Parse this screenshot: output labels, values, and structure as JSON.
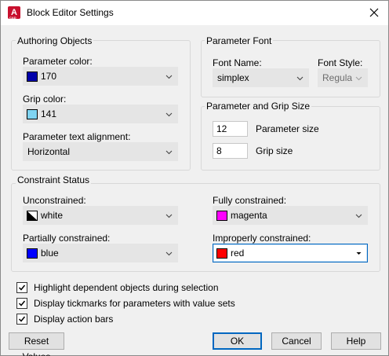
{
  "window": {
    "title": "Block Editor Settings",
    "app_icon_letter": "A",
    "app_icon_sub": "CAD"
  },
  "authoring": {
    "title": "Authoring Objects",
    "param_color_label": "Parameter color:",
    "param_color_value": "170",
    "param_color_swatch": "#0000aa",
    "grip_color_label": "Grip color:",
    "grip_color_value": "141",
    "grip_color_swatch": "#7fd4f2",
    "text_align_label": "Parameter text alignment:",
    "text_align_value": "Horizontal"
  },
  "param_font": {
    "title": "Parameter Font",
    "font_name_label": "Font Name:",
    "font_name_value": "simplex",
    "font_style_label": "Font Style:",
    "font_style_value": "Regula"
  },
  "size": {
    "title": "Parameter and Grip Size",
    "param_size_value": "12",
    "param_size_label": "Parameter size",
    "grip_size_value": "8",
    "grip_size_label": "Grip size"
  },
  "constraint": {
    "title": "Constraint Status",
    "unconstrained_label": "Unconstrained:",
    "unconstrained_value": "white",
    "fully_label": "Fully constrained:",
    "fully_value": "magenta",
    "fully_swatch": "#ff00ff",
    "partially_label": "Partially constrained:",
    "partially_value": "blue",
    "partially_swatch": "#0000ff",
    "improper_label": "Improperly constrained:",
    "improper_value": "red",
    "improper_swatch": "#ff0000"
  },
  "options": [
    {
      "label": "Highlight dependent objects during selection",
      "checked": true
    },
    {
      "label": "Display tickmarks for parameters with value sets",
      "checked": true
    },
    {
      "label": "Display action bars",
      "checked": true
    }
  ],
  "buttons": {
    "reset": "Reset Values",
    "ok": "OK",
    "cancel": "Cancel",
    "help": "Help"
  }
}
